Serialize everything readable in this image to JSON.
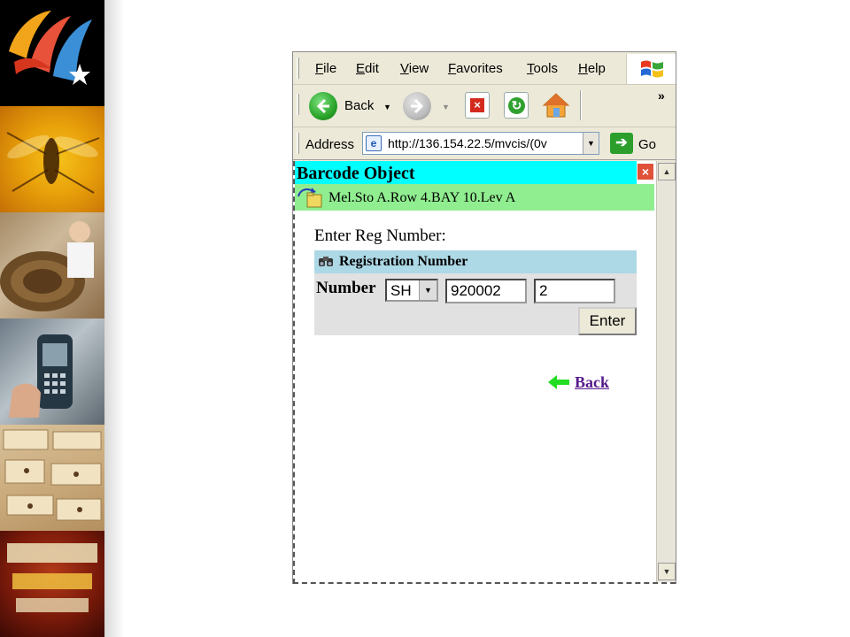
{
  "menu": {
    "items": [
      "File",
      "Edit",
      "View",
      "Favorites",
      "Tools",
      "Help"
    ]
  },
  "toolbar": {
    "back_label": "Back",
    "overflow_glyph": "»"
  },
  "address": {
    "label": "Address",
    "url": "http://136.154.22.5/mvcis/(0v",
    "go_label": "Go"
  },
  "page": {
    "title": "Barcode Object",
    "location": "Mel.Sto A.Row 4.BAY 10.Lev A",
    "prompt": "Enter Reg Number:",
    "panel_title": "Registration Number",
    "number_label": "Number",
    "prefix_selected": "SH",
    "reg_number": "920002",
    "reg_suffix": "2",
    "enter_label": "Enter",
    "back_link": "Back"
  },
  "colors": {
    "title_bar": "#00ffff",
    "location_bar": "#90ee90",
    "panel_header": "#add8e6",
    "link": "#551a8b"
  }
}
